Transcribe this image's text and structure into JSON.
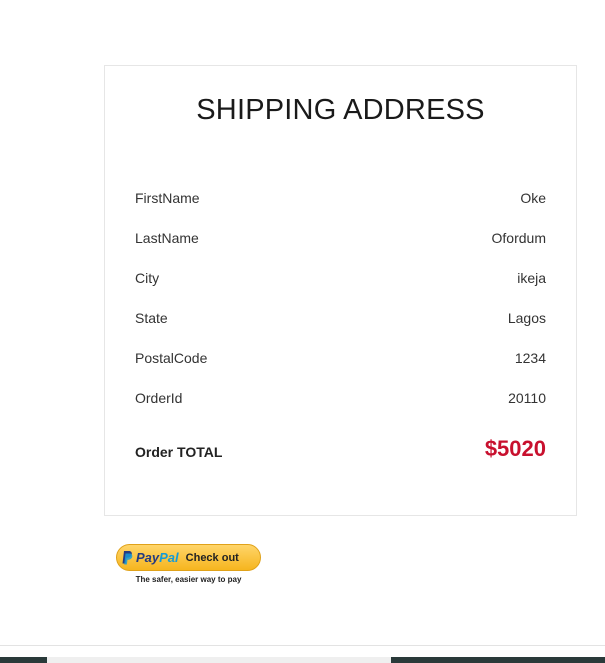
{
  "shipping": {
    "title": "SHIPPING ADDRESS",
    "fields": [
      {
        "label": "FirstName",
        "value": "Oke"
      },
      {
        "label": "LastName",
        "value": "Ofordum"
      },
      {
        "label": "City",
        "value": "ikeja"
      },
      {
        "label": "State",
        "value": "Lagos"
      },
      {
        "label": "PostalCode",
        "value": "1234"
      },
      {
        "label": "OrderId",
        "value": "20110"
      }
    ],
    "total_label": "Order TOTAL",
    "total_value": "$5020"
  },
  "paypal": {
    "brand_pay": "Pay",
    "brand_pal": "Pal",
    "checkout_label": "Check out",
    "tagline": "The safer, easier way to pay",
    "icon": "paypal-icon"
  },
  "colors": {
    "total": "#c8102e",
    "paypal_gold": "#f6b51e",
    "paypal_navy": "#253b80",
    "paypal_blue": "#179bd7"
  }
}
